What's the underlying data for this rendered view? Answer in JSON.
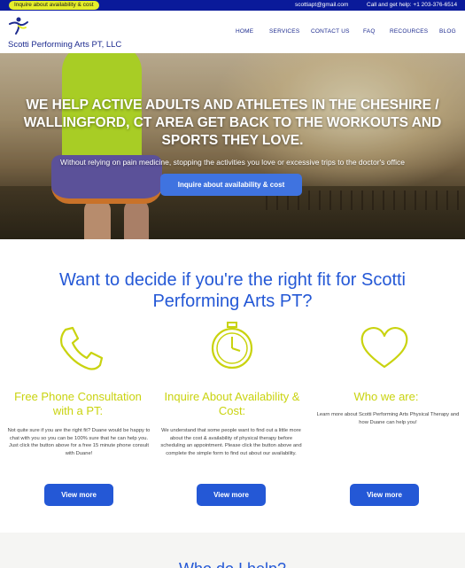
{
  "topbar": {
    "cta": "Inquire about availability & cost",
    "email": "scottiapt@gmail.com",
    "call": "Call and get help: +1 203-376-6514"
  },
  "header": {
    "logo_text": "Scotti Performing Arts PT, LLC",
    "nav": [
      "HOME",
      "SERVICES",
      "CONTACT US",
      "FAQ",
      "RECOURCES",
      "BLOG"
    ]
  },
  "hero": {
    "title": "WE HELP ACTIVE ADULTS AND ATHLETES IN THE CHESHIRE / WALLINGFORD, CT AREA GET BACK TO THE WORKOUTS AND SPORTS THEY LOVE.",
    "subtitle": "Without relying on pain medicine, stopping the activities you love or excessive trips to the doctor's office",
    "button": "Inquire about availability & cost"
  },
  "fit": {
    "title": "Want to decide if you're the right fit for Scotti Performing Arts PT?",
    "columns": [
      {
        "icon": "phone-icon",
        "title": "Free Phone Consultation with a PT:",
        "text": "Not quite sure if you are the right fit? Duane would be happy to chat with you so you can be 100% sure that he can help you. Just click the button above for a free 15 minute phone consult with Duane!",
        "button": "View more"
      },
      {
        "icon": "stopwatch-icon",
        "title": "Inquire About Availability & Cost:",
        "text": "We understand that some people want to find out a little more about the cost & availability of physical therapy before scheduling an appointment. Please click the button above and complete the simple form to find out about our availability.",
        "button": "View more"
      },
      {
        "icon": "heart-icon",
        "title": "Who we are:",
        "text": "Learn more about Scotti Performing Arts Physical Therapy and how Duane can help you!",
        "button": "View more"
      }
    ]
  },
  "bottom": {
    "title": "Who do I help?"
  },
  "colors": {
    "brand_blue": "#2458d6",
    "navy": "#0a1a9a",
    "accent_yellow": "#c9d30f"
  }
}
